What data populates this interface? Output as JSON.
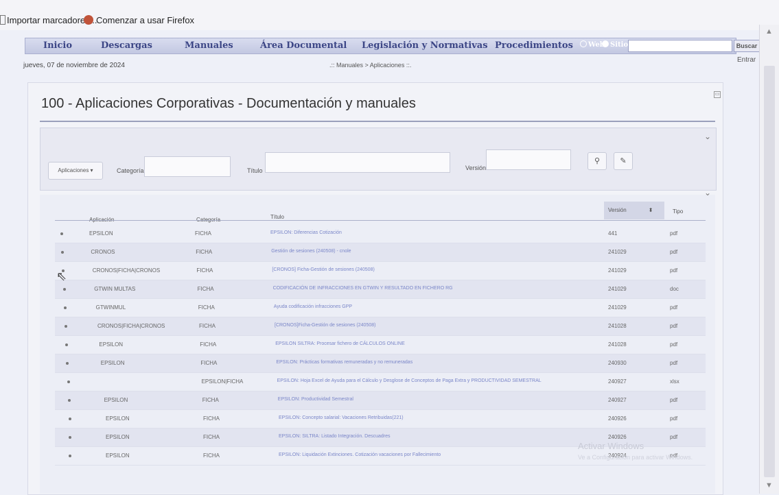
{
  "bookmarks": [
    {
      "label": "Importar marcadores...",
      "icon": "import-icon"
    },
    {
      "label": "Comenzar a usar Firefox",
      "icon": "firefox-icon"
    }
  ],
  "nav": {
    "items": [
      "Inicio",
      "Descargas",
      "Manuales",
      "Área Documental",
      "Legislación y Normativas",
      "Procedimientos"
    ],
    "radio_web": "Web",
    "radio_site": "Sitio",
    "search_button": "Buscar"
  },
  "side_link": "Entrar",
  "date": "jueves, 07 de noviembre de 2024",
  "breadcrumb": ".:: Manuales > Aplicaciones ::.",
  "page_title": "100 - Aplicaciones Corporativas - Documentación y manuales",
  "filters": {
    "app_dropdown": "Aplicaciones",
    "categoria_label": "Categoría",
    "titulo_label": "Título",
    "version_label": "Versión"
  },
  "table": {
    "headers": {
      "aplicacion": "Aplicación",
      "categoria": "Categoría",
      "titulo": "Título",
      "version": "Versión",
      "tipo": "Tipo"
    },
    "rows": [
      {
        "aplicacion": "EPSILON",
        "categoria": "FICHA",
        "titulo": "EPSILON: Diferencias Cotización",
        "version": "441",
        "tipo": "pdf"
      },
      {
        "aplicacion": "CRONOS",
        "categoria": "FICHA",
        "titulo": "Gestión de sesiones (240508) - cnole",
        "version": "241029",
        "tipo": "pdf"
      },
      {
        "aplicacion": "CRONOS|FICHA|CRONOS",
        "categoria": "FICHA",
        "titulo": "[CRONOS] Ficha-Gestión de sesiones (240508)",
        "version": "241029",
        "tipo": "pdf"
      },
      {
        "aplicacion": "GTWIN MULTAS",
        "categoria": "FICHA",
        "titulo": "CODIFICACIÓN DE INFRACCIONES EN GTWIN Y RESULTADO EN FICHERO RG",
        "version": "241029",
        "tipo": "doc"
      },
      {
        "aplicacion": "GTWINMUL",
        "categoria": "FICHA",
        "titulo": "Ayuda codificación infracciones GPP",
        "version": "241029",
        "tipo": "pdf"
      },
      {
        "aplicacion": "CRONOS|FICHA|CRONOS",
        "categoria": "FICHA",
        "titulo": "[CRONOS]Ficha-Gestión de sesiones (240508)",
        "version": "241028",
        "tipo": "pdf"
      },
      {
        "aplicacion": "EPSILON",
        "categoria": "FICHA",
        "titulo": "EPSILON SILTRA: Procesar fichero de CÁLCULOS ONLINE",
        "version": "241028",
        "tipo": "pdf"
      },
      {
        "aplicacion": "EPSILON",
        "categoria": "FICHA",
        "titulo": "EPSILON: Prácticas formativas remuneradas y no remuneradas",
        "version": "240930",
        "tipo": "pdf"
      },
      {
        "aplicacion": "",
        "categoria": "EPSILON|FICHA",
        "titulo": "EPSILON: Hoja Excel de Ayuda para el Cálculo y Desglose de Conceptos de Paga Extra y PRODUCTIVIDAD SEMESTRAL",
        "version": "240927",
        "tipo": "xlsx"
      },
      {
        "aplicacion": "EPSILON",
        "categoria": "FICHA",
        "titulo": "EPSILON: Productividad Semestral",
        "version": "240927",
        "tipo": "pdf"
      },
      {
        "aplicacion": "EPSILON",
        "categoria": "FICHA",
        "titulo": "EPSILON: Concepto salarial: Vacaciones Retribuidas(221)",
        "version": "240926",
        "tipo": "pdf"
      },
      {
        "aplicacion": "EPSILON",
        "categoria": "FICHA",
        "titulo": "EPSILON: SILTRA: Listado Integración. Descuadres",
        "version": "240926",
        "tipo": "pdf"
      },
      {
        "aplicacion": "EPSILON",
        "categoria": "FICHA",
        "titulo": "EPSILON: Liquidación Extinciones. Cotización vacaciones por Fallecimiento",
        "version": "240924",
        "tipo": "pdf"
      }
    ]
  },
  "watermark": {
    "line1": "Activar Windows",
    "line2": "Ve a Configuración para activar Windows."
  }
}
